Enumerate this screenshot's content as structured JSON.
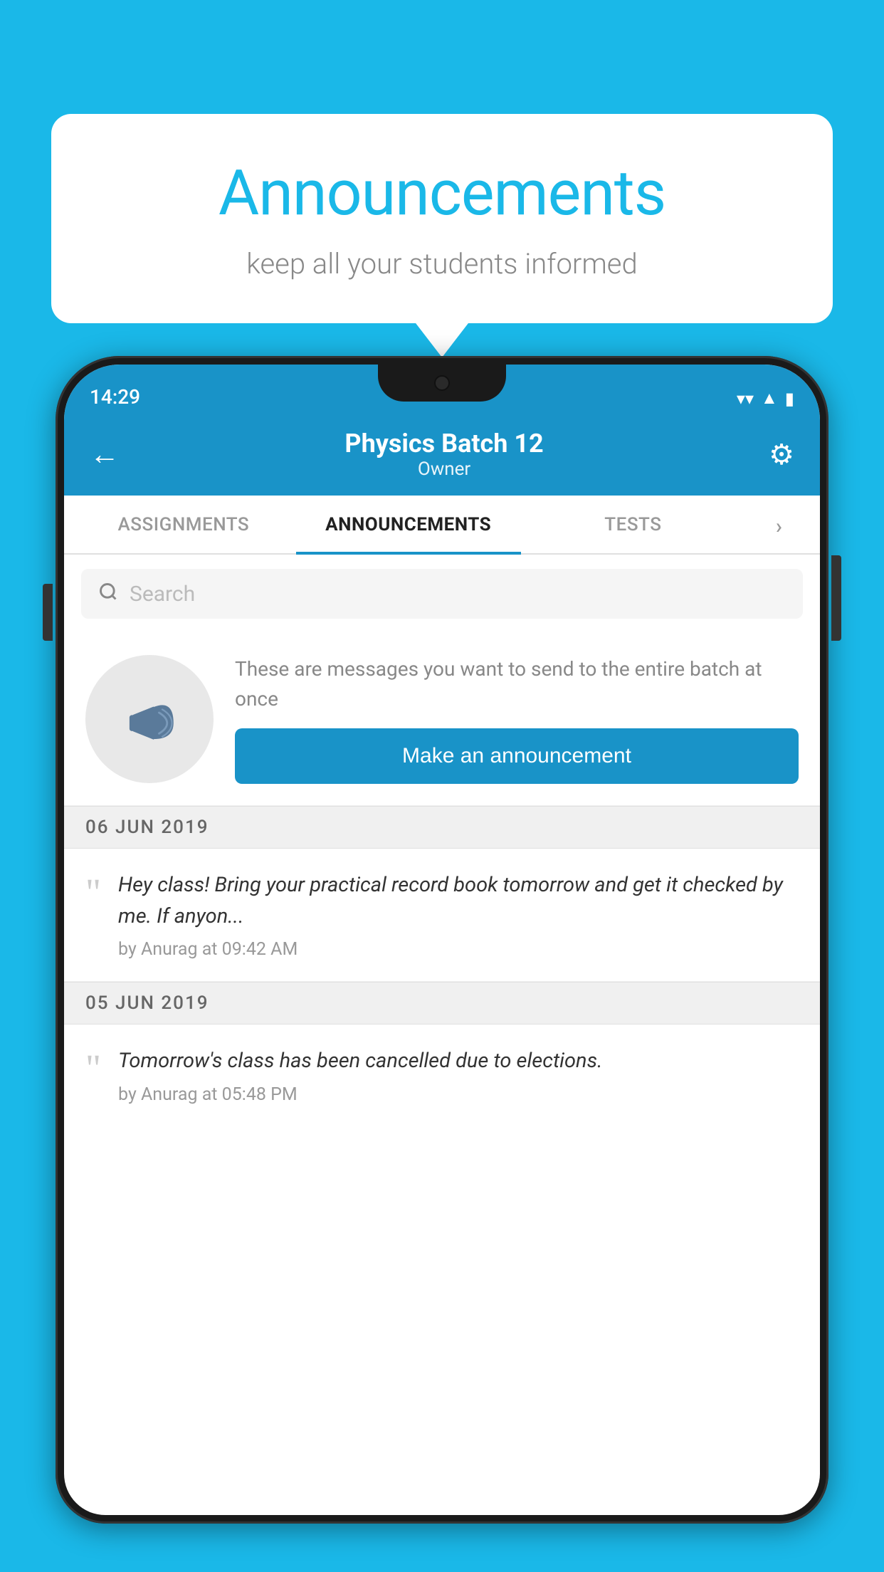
{
  "background_color": "#1ab8e8",
  "speech_bubble": {
    "title": "Announcements",
    "subtitle": "keep all your students informed"
  },
  "status_bar": {
    "time": "14:29",
    "wifi": "▼",
    "signal": "▲",
    "battery": "▮"
  },
  "header": {
    "title": "Physics Batch 12",
    "subtitle": "Owner",
    "back_label": "←",
    "gear_label": "⚙"
  },
  "tabs": [
    {
      "label": "ASSIGNMENTS",
      "active": false
    },
    {
      "label": "ANNOUNCEMENTS",
      "active": true
    },
    {
      "label": "TESTS",
      "active": false
    },
    {
      "label": "›",
      "active": false
    }
  ],
  "search": {
    "placeholder": "Search"
  },
  "promo": {
    "description": "These are messages you want to\nsend to the entire batch at once",
    "button_label": "Make an announcement"
  },
  "announcements": [
    {
      "date": "06  JUN  2019",
      "text": "Hey class! Bring your practical record book tomorrow and get it checked by me. If anyon...",
      "meta": "by Anurag at 09:42 AM"
    },
    {
      "date": "05  JUN  2019",
      "text": "Tomorrow's class has been cancelled due to elections.",
      "meta": "by Anurag at 05:48 PM"
    }
  ]
}
